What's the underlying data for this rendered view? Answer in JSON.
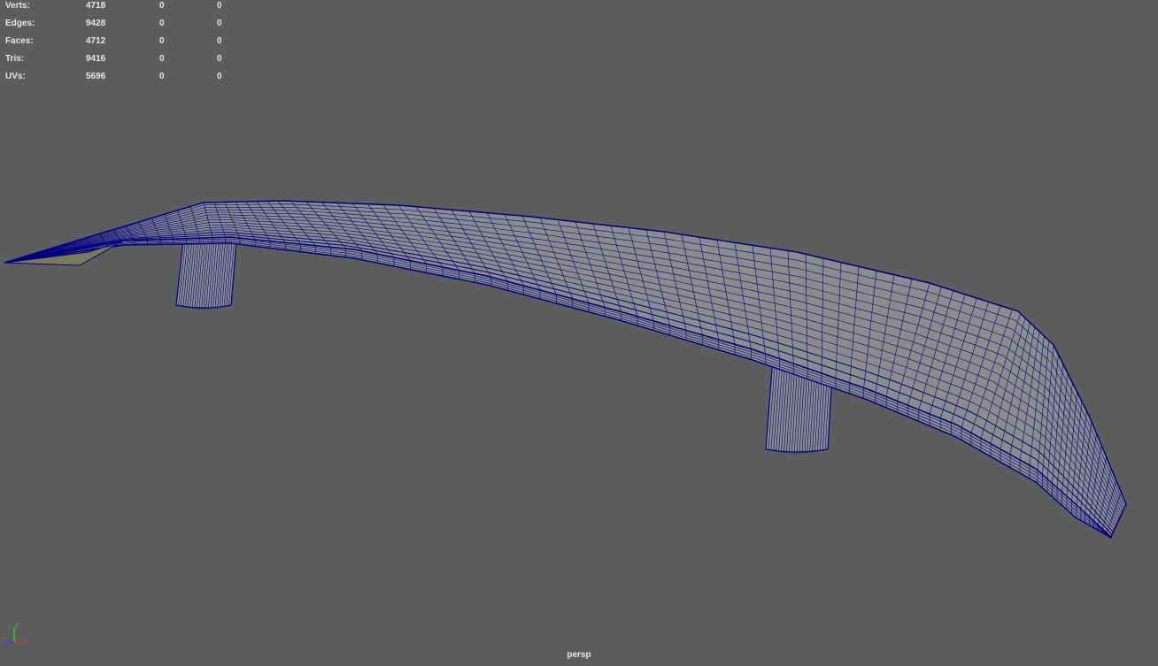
{
  "hud": {
    "rows": [
      {
        "label": "Verts:",
        "total": "4718",
        "selected": "0",
        "component": "0"
      },
      {
        "label": "Edges:",
        "total": "9428",
        "selected": "0",
        "component": "0"
      },
      {
        "label": "Faces:",
        "total": "4712",
        "selected": "0",
        "component": "0"
      },
      {
        "label": "Tris:",
        "total": "9416",
        "selected": "0",
        "component": "0"
      },
      {
        "label": "UVs:",
        "total": "5696",
        "selected": "0",
        "component": "0"
      }
    ]
  },
  "camera": {
    "name": "persp"
  },
  "axis": {
    "x": "x",
    "y": "y",
    "z": "z"
  },
  "colors": {
    "background": "#5d5d5d",
    "wire": "#000080",
    "surface": "#8c8c8c",
    "x_axis": "#e03030",
    "y_axis": "#30d030",
    "z_axis": "#3040e0"
  }
}
